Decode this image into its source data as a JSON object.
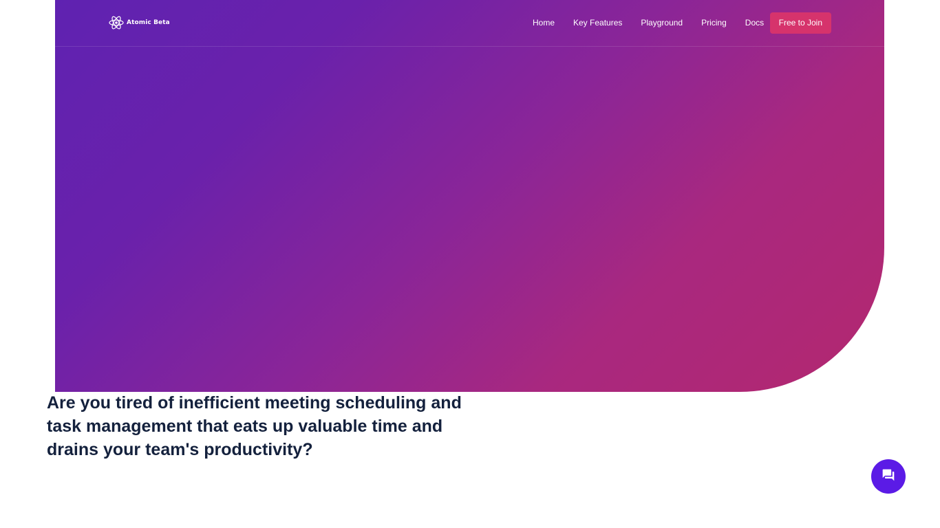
{
  "header": {
    "logo_text": "Atomic Beta",
    "logo_icon": "atom-icon",
    "nav": [
      {
        "label": "Home"
      },
      {
        "label": "Key Features"
      },
      {
        "label": "Playground"
      },
      {
        "label": "Pricing"
      },
      {
        "label": "Docs"
      }
    ],
    "cta_label": "Free to Join"
  },
  "hero": {
    "gradient_colors": [
      "#5f22b1",
      "#8a2598",
      "#b3286f"
    ],
    "headline": "Are you tired of inefficient meeting scheduling and task management that eats up valuable time and drains your team's productivity?"
  },
  "chat_widget": {
    "icon": "chat-icon",
    "color": "#5b1be6"
  },
  "colors": {
    "cta": "#d6336c",
    "headline": "#14213d"
  }
}
